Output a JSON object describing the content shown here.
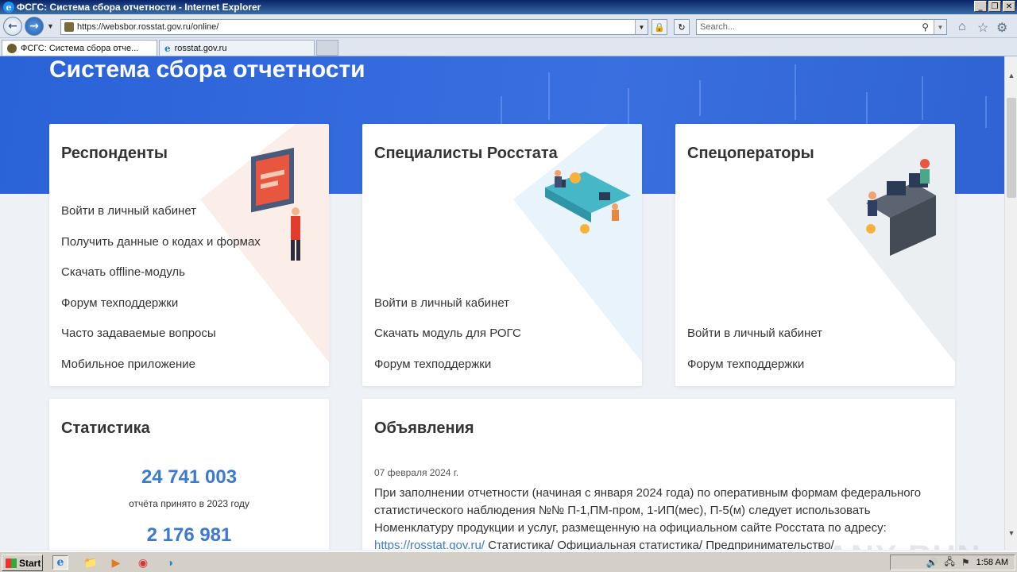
{
  "window": {
    "title": "ФСГС: Система сбора отчетности - Internet Explorer",
    "controls": [
      "_",
      "❐",
      "✕"
    ]
  },
  "addressbar": {
    "url": "https://websbor.rosstat.gov.ru/online/",
    "search_placeholder": "Search..."
  },
  "tabs": [
    {
      "label": "ФСГС: Система сбора отче...",
      "active": true
    },
    {
      "label": "rosstat.gov.ru",
      "active": false
    }
  ],
  "page": {
    "hero_title": "Система сбора отчетности",
    "cards": [
      {
        "title": "Респонденты",
        "links": [
          "Войти в личный кабинет",
          "Получить данные о кодах и формах",
          "Скачать offline-модуль",
          "Форум техподдержки",
          "Часто задаваемые вопросы",
          "Мобильное приложение"
        ]
      },
      {
        "title": "Специалисты Росстата",
        "links": [
          "Войти в личный кабинет",
          "Скачать модуль для РОГС",
          "Форум техподдержки"
        ]
      },
      {
        "title": "Спецоператоры",
        "links": [
          "Войти в личный кабинет",
          "Форум техподдержки"
        ]
      }
    ],
    "statistics": {
      "title": "Статистика",
      "items": [
        {
          "value": "24 741 003",
          "caption": "отчёта принято в 2023 году"
        },
        {
          "value": "2 176 981",
          "caption": ""
        }
      ]
    },
    "announcements": {
      "title": "Объявления",
      "date": "07 февраля 2024 г.",
      "text": "При заполнении отчетности (начиная с января 2024 года) по оперативным формам федерального статистического наблюдения №№ П-1,ПМ-пром, 1-ИП(мес), П-5(м) следует использовать Номенклатуру продукции и услуг, размещенную на официальном сайте Росстата по адресу:",
      "link": "https://rosstat.gov.ru/",
      "link_tail": " Статистика/ Официальная статистика/ Предпринимательство/"
    }
  },
  "watermark": "ANY RUN",
  "taskbar": {
    "start_label": "Start",
    "clock": "1:58 AM"
  },
  "colors": {
    "hero_blue": "#2a62d8",
    "stat_blue": "#3c7ad0"
  }
}
